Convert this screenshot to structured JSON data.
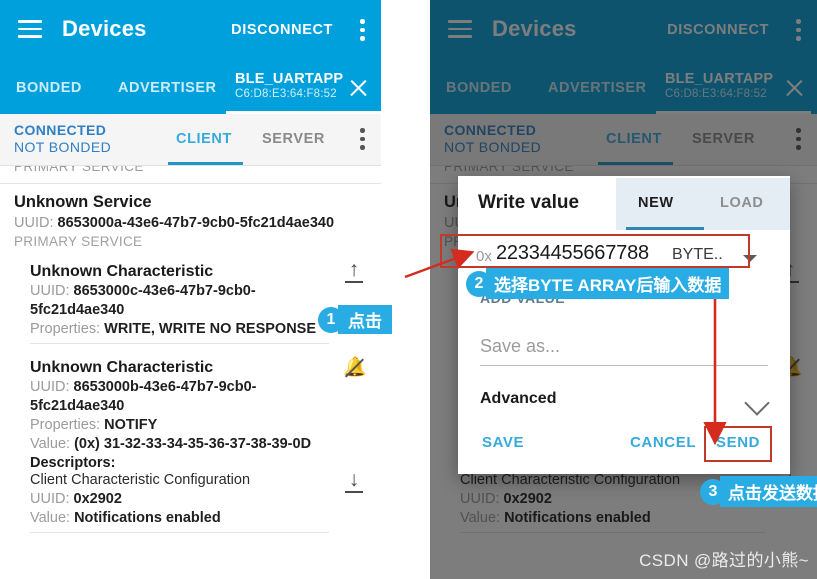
{
  "appbar": {
    "title": "Devices",
    "disconnect_label": "DISCONNECT",
    "menu_icon": "kebab-menu-icon",
    "nav_icon": "hamburger-icon"
  },
  "device_tabs": {
    "bonded": "BONDED",
    "advertiser": "ADVERTISER",
    "device_name": "BLE_UARTAPP",
    "device_address": "C6:D8:E3:64:F8:52",
    "close_icon": "close-icon"
  },
  "status_bar": {
    "connection_line1": "CONNECTED",
    "connection_line2": "NOT BONDED",
    "client_tab": "CLIENT",
    "server_tab": "SERVER"
  },
  "list": {
    "clipped_top_label": "PRIMARY SERVICE",
    "service": {
      "title": "Unknown Service",
      "uuid_key": "UUID:",
      "uuid_value": "8653000a-43e6-47b7-9cb0-5fc21d4ae340",
      "type_label": "PRIMARY SERVICE"
    },
    "characteristics": [
      {
        "title": "Unknown Characteristic",
        "uuid_key": "UUID:",
        "uuid_value": "8653000c-43e6-47b7-9cb0-5fc21d4ae340",
        "properties_key": "Properties:",
        "properties_value": "WRITE, WRITE NO RESPONSE",
        "action_icon": "upload-write-icon"
      },
      {
        "title": "Unknown Characteristic",
        "uuid_key": "UUID:",
        "uuid_value": "8653000b-43e6-47b7-9cb0-5fc21d4ae340",
        "properties_key": "Properties:",
        "properties_value": "NOTIFY",
        "value_key": "Value:",
        "value_value": "(0x) 31-32-33-34-35-36-37-38-39-0D",
        "descriptors_label": "Descriptors:",
        "descriptor_name": "Client Characteristic Configuration",
        "descriptor_uuid_key": "UUID:",
        "descriptor_uuid_value": "0x2902",
        "descriptor_value_key": "Value:",
        "descriptor_value_value": "Notifications enabled",
        "action_icon": "notifications-off-icon",
        "descriptor_action_icon": "download-read-icon"
      }
    ]
  },
  "dialog": {
    "title": "Write value",
    "tab_new": "NEW",
    "tab_load": "LOAD",
    "value_prefix": "0x",
    "value_text": "22334455667788",
    "value_type": "BYTE..",
    "type_caret_icon": "chevron-down-icon",
    "add_value_label": "ADD VALUE",
    "save_as_placeholder": "Save as...",
    "advanced_label": "Advanced",
    "advanced_chevron_icon": "chevron-down-icon",
    "save_label": "SAVE",
    "cancel_label": "CANCEL",
    "send_label": "SEND"
  },
  "annotations": [
    {
      "number": "1",
      "text": "点击"
    },
    {
      "number": "2",
      "text": "选择BYTE ARRAY后输入数据"
    },
    {
      "number": "3",
      "text": "点击发送数据"
    }
  ],
  "watermark": "CSDN @路过的小熊~",
  "colors": {
    "brand_blue": "#00a0dc",
    "accent_blue": "#29ace3",
    "annotation_red": "#c0392b"
  }
}
